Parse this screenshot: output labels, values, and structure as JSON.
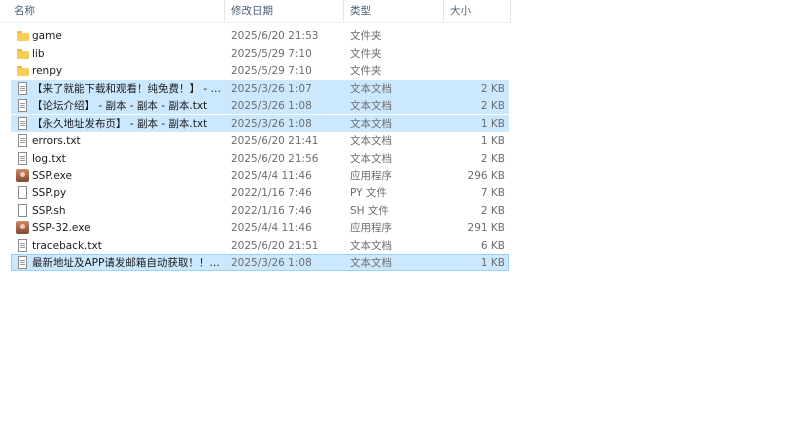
{
  "columns": {
    "name": "名称",
    "modified": "修改日期",
    "type": "类型",
    "size": "大小"
  },
  "files": [
    {
      "name": "game",
      "modified": "2025/6/20 21:53",
      "type": "文件夹",
      "size": "",
      "icon": "folder-icon",
      "selected": false
    },
    {
      "name": "lib",
      "modified": "2025/5/29 7:10",
      "type": "文件夹",
      "size": "",
      "icon": "folder-icon",
      "selected": false
    },
    {
      "name": "renpy",
      "modified": "2025/5/29 7:10",
      "type": "文件夹",
      "size": "",
      "icon": "folder-icon",
      "selected": false
    },
    {
      "name": "【来了就能下载和观看！纯免费！】 - 副...",
      "modified": "2025/3/26 1:07",
      "type": "文本文档",
      "size": "2 KB",
      "icon": "text-file-icon",
      "selected": true
    },
    {
      "name": "【论坛介绍】 - 副本 - 副本 - 副本.txt",
      "modified": "2025/3/26 1:08",
      "type": "文本文档",
      "size": "2 KB",
      "icon": "text-file-icon",
      "selected": true
    },
    {
      "name": "【永久地址发布页】 - 副本 - 副本.txt",
      "modified": "2025/3/26 1:08",
      "type": "文本文档",
      "size": "1 KB",
      "icon": "text-file-icon",
      "selected": true
    },
    {
      "name": "errors.txt",
      "modified": "2025/6/20 21:41",
      "type": "文本文档",
      "size": "1 KB",
      "icon": "text-file-icon",
      "selected": false
    },
    {
      "name": "log.txt",
      "modified": "2025/6/20 21:56",
      "type": "文本文档",
      "size": "2 KB",
      "icon": "text-file-icon",
      "selected": false
    },
    {
      "name": "SSP.exe",
      "modified": "2025/4/4 11:46",
      "type": "应用程序",
      "size": "296 KB",
      "icon": "application-icon",
      "selected": false
    },
    {
      "name": "SSP.py",
      "modified": "2022/1/16 7:46",
      "type": "PY 文件",
      "size": "7 KB",
      "icon": "file-icon",
      "selected": false
    },
    {
      "name": "SSP.sh",
      "modified": "2022/1/16 7:46",
      "type": "SH 文件",
      "size": "2 KB",
      "icon": "file-icon",
      "selected": false
    },
    {
      "name": "SSP-32.exe",
      "modified": "2025/4/4 11:46",
      "type": "应用程序",
      "size": "291 KB",
      "icon": "application-icon",
      "selected": false
    },
    {
      "name": "traceback.txt",
      "modified": "2025/6/20 21:51",
      "type": "文本文档",
      "size": "6 KB",
      "icon": "text-file-icon",
      "selected": false
    },
    {
      "name": "最新地址及APP请发邮箱自动获取！！！...",
      "modified": "2025/3/26 1:08",
      "type": "文本文档",
      "size": "1 KB",
      "icon": "text-file-icon",
      "selected": true
    }
  ],
  "colors": {
    "selection": "#cce8ff",
    "focus_border": "#99d1ff",
    "header_text": "#4c607a",
    "folder": "#f6cd55"
  }
}
